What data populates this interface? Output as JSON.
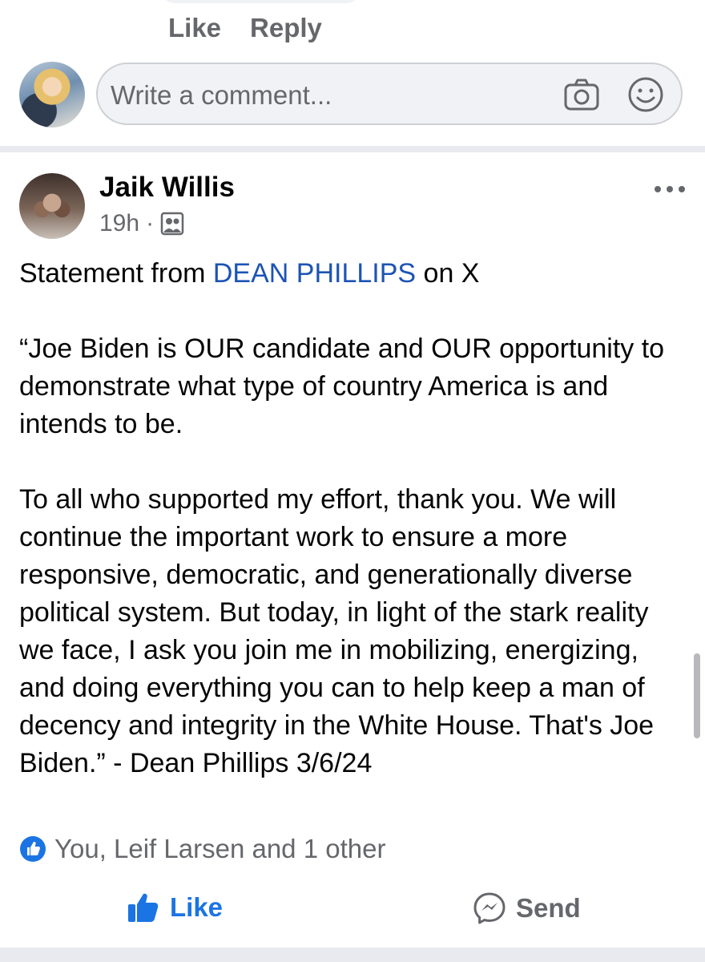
{
  "previous_comment": {
    "like_label": "Like",
    "reply_label": "Reply"
  },
  "comment_composer": {
    "placeholder": "Write a comment..."
  },
  "post": {
    "author": "Jaik Willis",
    "time": "19h",
    "separator": "·",
    "audience_icon": "friends-icon",
    "text_prefix": "Statement from ",
    "mention": "DEAN PHILLIPS",
    "text_suffix": " on X",
    "paragraph_1": "“Joe Biden is OUR candidate and OUR opportunity to demonstrate what type of country America is and intends to be.",
    "paragraph_2": "To all who supported my effort, thank you. We will continue the important work to ensure a more responsive, democratic, and generationally diverse political system. But today, in light of the stark reality we face, I ask you join me in mobilizing, energizing, and doing everything you can to help keep a man of decency and integrity in the White House. That's Joe Biden.” - Dean Phillips 3/6/24"
  },
  "reactions": {
    "summary": "You, Leif Larsen and 1 other",
    "icon": "like-badge-icon"
  },
  "actions": {
    "like_label": "Like",
    "send_label": "Send"
  },
  "colors": {
    "accent": "#1b74e4",
    "mention": "#1d54b4",
    "secondary_text": "#65676b",
    "input_bg": "#f0f2f5"
  }
}
